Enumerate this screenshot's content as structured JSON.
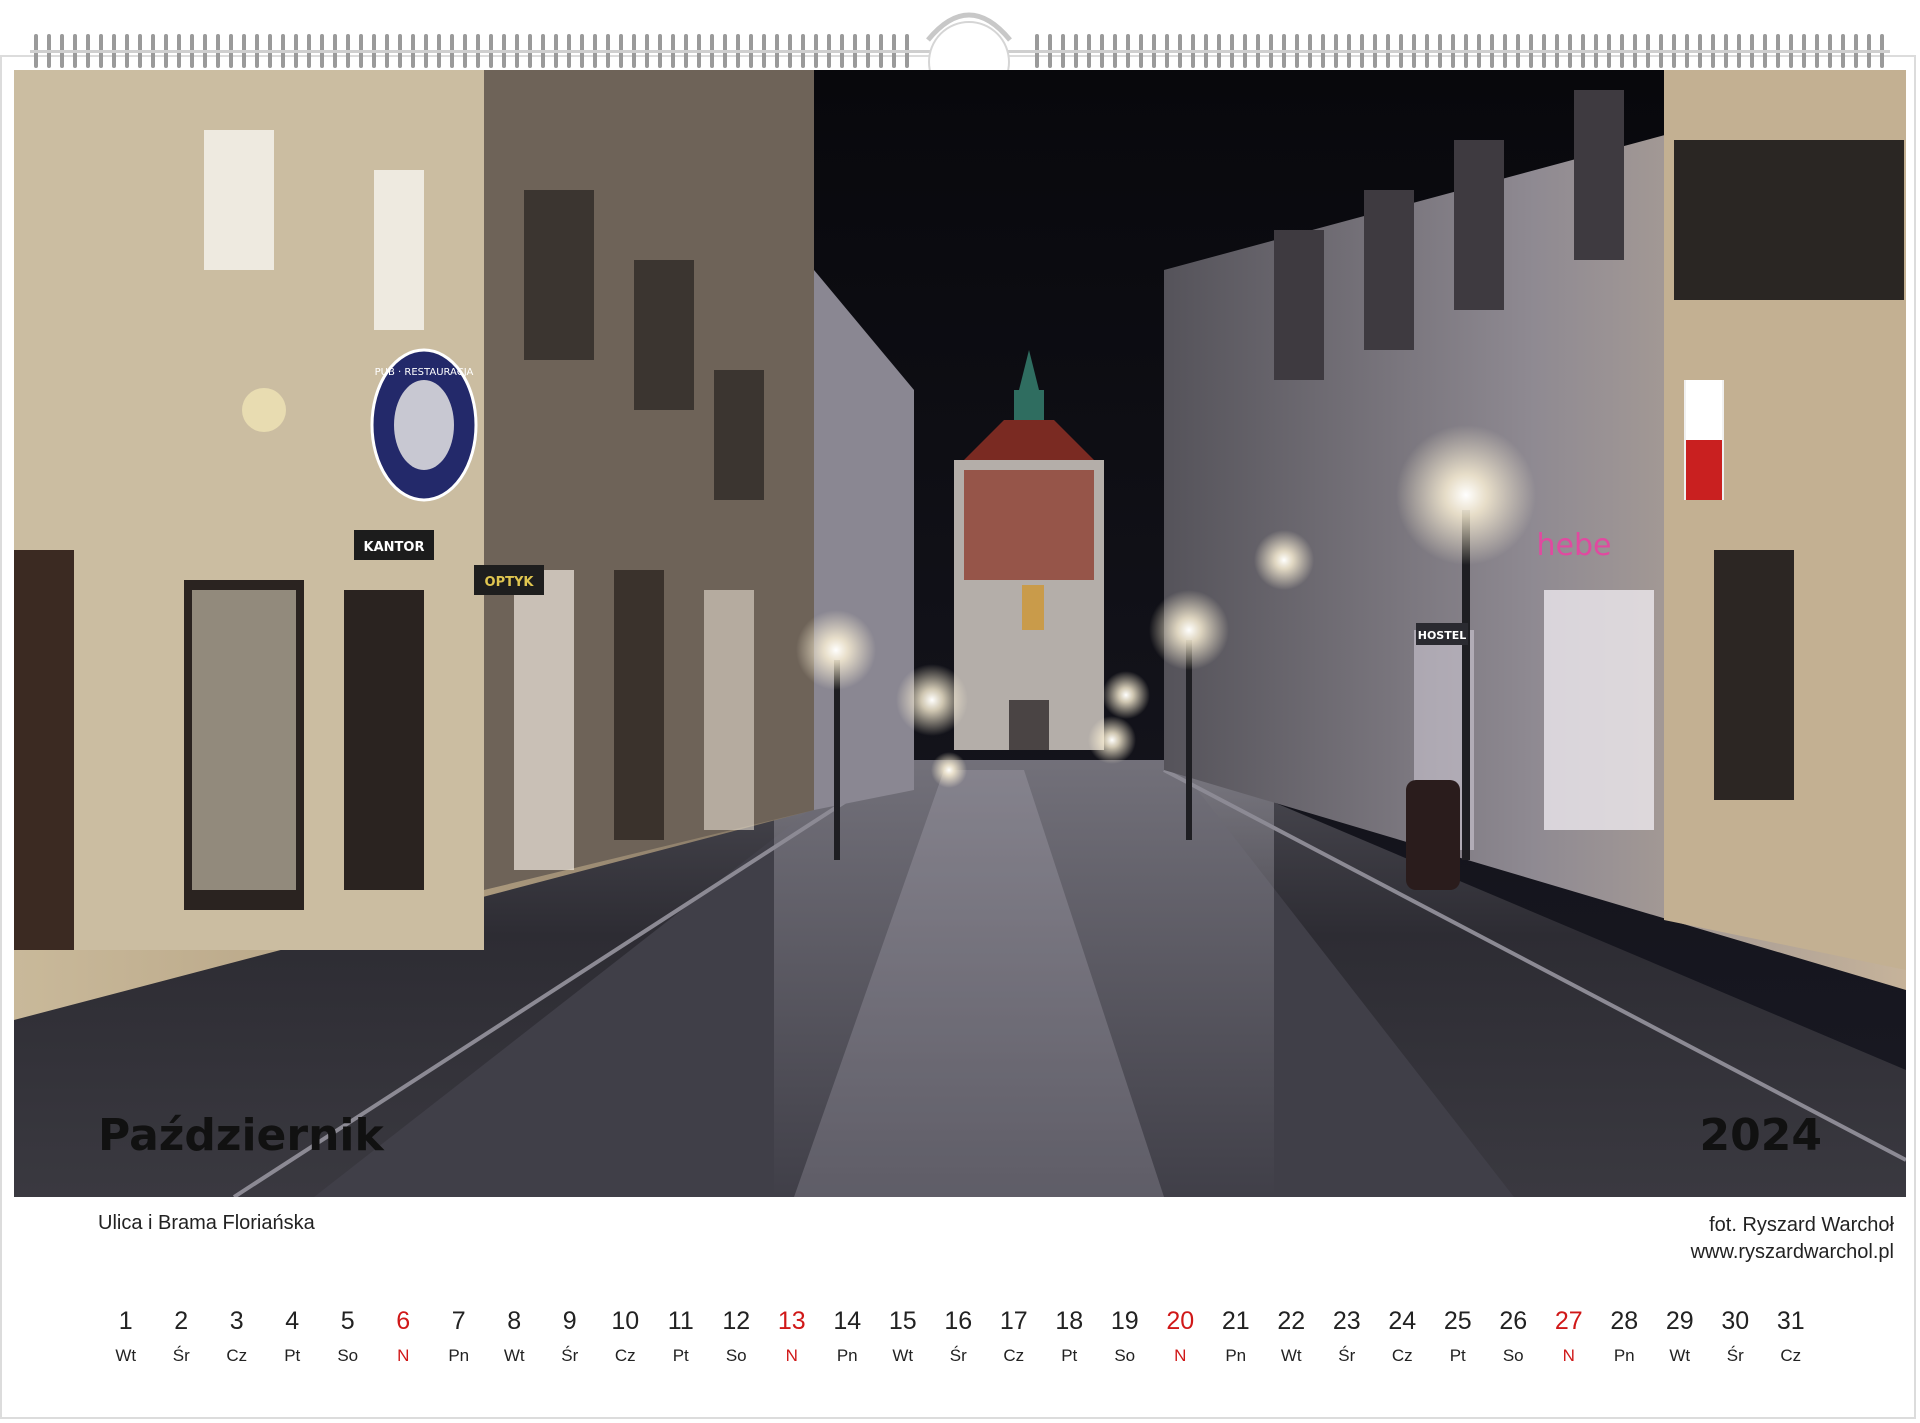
{
  "calendar": {
    "month": "Październik",
    "year": "2024",
    "caption": "Ulica i Brama Floriańska",
    "credit_line1": "fot. Ryszard Warchoł",
    "credit_line2": "www.ryszardwarchol.pl",
    "sunday_color": "#d01818",
    "days": [
      {
        "num": "1",
        "wd": "Wt"
      },
      {
        "num": "2",
        "wd": "Śr"
      },
      {
        "num": "3",
        "wd": "Cz"
      },
      {
        "num": "4",
        "wd": "Pt"
      },
      {
        "num": "5",
        "wd": "So"
      },
      {
        "num": "6",
        "wd": "N"
      },
      {
        "num": "7",
        "wd": "Pn"
      },
      {
        "num": "8",
        "wd": "Wt"
      },
      {
        "num": "9",
        "wd": "Śr"
      },
      {
        "num": "10",
        "wd": "Cz"
      },
      {
        "num": "11",
        "wd": "Pt"
      },
      {
        "num": "12",
        "wd": "So"
      },
      {
        "num": "13",
        "wd": "N"
      },
      {
        "num": "14",
        "wd": "Pn"
      },
      {
        "num": "15",
        "wd": "Wt"
      },
      {
        "num": "16",
        "wd": "Śr"
      },
      {
        "num": "17",
        "wd": "Cz"
      },
      {
        "num": "18",
        "wd": "Pt"
      },
      {
        "num": "19",
        "wd": "So"
      },
      {
        "num": "20",
        "wd": "N"
      },
      {
        "num": "21",
        "wd": "Pn"
      },
      {
        "num": "22",
        "wd": "Wt"
      },
      {
        "num": "23",
        "wd": "Śr"
      },
      {
        "num": "24",
        "wd": "Cz"
      },
      {
        "num": "25",
        "wd": "Pt"
      },
      {
        "num": "26",
        "wd": "So"
      },
      {
        "num": "27",
        "wd": "N"
      },
      {
        "num": "28",
        "wd": "Pn"
      },
      {
        "num": "29",
        "wd": "Wt"
      },
      {
        "num": "30",
        "wd": "Śr"
      },
      {
        "num": "31",
        "wd": "Cz"
      }
    ]
  },
  "photo": {
    "sign_texts": [
      "PUB · RESTAURACJA",
      "KANTOR",
      "OPTYK",
      "HOSTEL",
      "hebe"
    ]
  }
}
